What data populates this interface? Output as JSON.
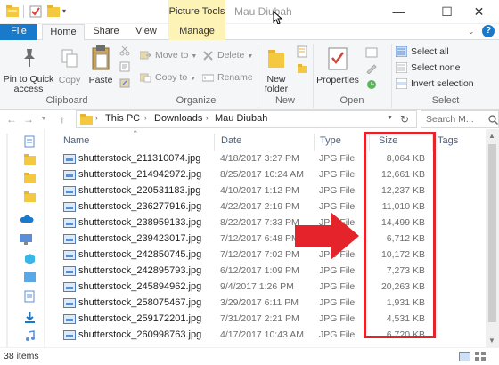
{
  "window": {
    "title": "Mau Diubah",
    "context_tab_group": "Picture Tools",
    "controls": {
      "minimize": "—",
      "maximize": "☐",
      "close": "✕"
    }
  },
  "tabs": [
    {
      "label": "File"
    },
    {
      "label": "Home"
    },
    {
      "label": "Share"
    },
    {
      "label": "View"
    },
    {
      "label": "Manage"
    }
  ],
  "ribbon": {
    "clipboard": {
      "label": "Clipboard",
      "pin_line1": "Pin to Quick",
      "pin_line2": "access",
      "copy": "Copy",
      "paste": "Paste"
    },
    "organize": {
      "label": "Organize",
      "move_to": "Move to",
      "copy_to": "Copy to",
      "delete": "Delete",
      "rename": "Rename"
    },
    "new": {
      "label": "New",
      "new_folder_line1": "New",
      "new_folder_line2": "folder"
    },
    "open": {
      "label": "Open",
      "properties": "Properties"
    },
    "select": {
      "label": "Select",
      "select_all": "Select all",
      "select_none": "Select none",
      "invert_selection": "Invert selection"
    }
  },
  "address": {
    "crumbs": [
      "This PC",
      "Downloads",
      "Mau Diubah"
    ],
    "search_placeholder": "Search M..."
  },
  "columns": {
    "name": "Name",
    "date": "Date",
    "type": "Type",
    "size": "Size",
    "tags": "Tags"
  },
  "files": [
    {
      "name": "shutterstock_211310074.jpg",
      "date": "4/18/2017 3:27 PM",
      "type": "JPG File",
      "size": "8,064 KB"
    },
    {
      "name": "shutterstock_214942972.jpg",
      "date": "8/25/2017 10:24 AM",
      "type": "JPG File",
      "size": "12,661 KB"
    },
    {
      "name": "shutterstock_220531183.jpg",
      "date": "4/10/2017 1:12 PM",
      "type": "JPG File",
      "size": "12,237 KB"
    },
    {
      "name": "shutterstock_236277916.jpg",
      "date": "4/22/2017 2:19 PM",
      "type": "JPG File",
      "size": "11,010 KB"
    },
    {
      "name": "shutterstock_238959133.jpg",
      "date": "8/22/2017 7:33 PM",
      "type": "JPG File",
      "size": "14,499 KB"
    },
    {
      "name": "shutterstock_239423017.jpg",
      "date": "7/12/2017 6:48 PM",
      "type": "JPG File",
      "size": "6,712 KB"
    },
    {
      "name": "shutterstock_242850745.jpg",
      "date": "7/12/2017 7:02 PM",
      "type": "JPG File",
      "size": "10,172 KB"
    },
    {
      "name": "shutterstock_242895793.jpg",
      "date": "6/12/2017 1:09 PM",
      "type": "JPG File",
      "size": "7,273 KB"
    },
    {
      "name": "shutterstock_245894962.jpg",
      "date": "9/4/2017 1:26 PM",
      "type": "JPG File",
      "size": "20,263 KB"
    },
    {
      "name": "shutterstock_258075467.jpg",
      "date": "3/29/2017 6:11 PM",
      "type": "JPG File",
      "size": "1,931 KB"
    },
    {
      "name": "shutterstock_259172201.jpg",
      "date": "7/31/2017 2:21 PM",
      "type": "JPG File",
      "size": "4,531 KB"
    },
    {
      "name": "shutterstock_260998763.jpg",
      "date": "4/17/2017 10:43 AM",
      "type": "JPG File",
      "size": "6,720 KB"
    }
  ],
  "status": {
    "item_count": "38 items"
  },
  "colors": {
    "file_tab": "#1979ca",
    "context_tab": "#fdf3b6",
    "highlight": "#e4232a",
    "folder": "#f5c842"
  }
}
